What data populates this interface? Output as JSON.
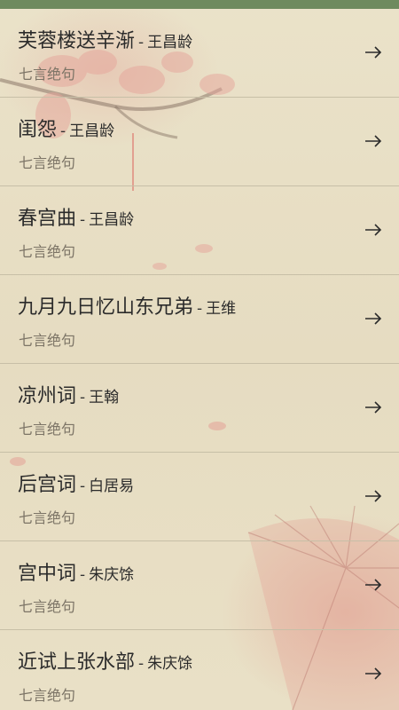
{
  "poems": [
    {
      "title": "芙蓉楼送辛渐",
      "sep": "-",
      "author": "王昌龄",
      "genre": "七言绝句"
    },
    {
      "title": "闺怨",
      "sep": "-",
      "author": "王昌龄",
      "genre": "七言绝句"
    },
    {
      "title": "春宫曲",
      "sep": "-",
      "author": "王昌龄",
      "genre": "七言绝句"
    },
    {
      "title": "九月九日忆山东兄弟",
      "sep": "-",
      "author": "王维",
      "genre": "七言绝句"
    },
    {
      "title": "凉州词",
      "sep": "-",
      "author": "王翰",
      "genre": "七言绝句"
    },
    {
      "title": "后宫词",
      "sep": "-",
      "author": "白居易",
      "genre": "七言绝句"
    },
    {
      "title": "宫中词",
      "sep": "-",
      "author": "朱庆馀",
      "genre": "七言绝句"
    },
    {
      "title": "近试上张水部",
      "sep": "-",
      "author": "朱庆馀",
      "genre": "七言绝句"
    }
  ],
  "colors": {
    "top_bar": "#6e8a5e",
    "background": "#e8dfc5",
    "title_text": "#2b2b2b",
    "genre_text": "#7c7466",
    "divider": "#c7bfa7"
  },
  "icons": {
    "row_action": "arrow-right-icon"
  }
}
